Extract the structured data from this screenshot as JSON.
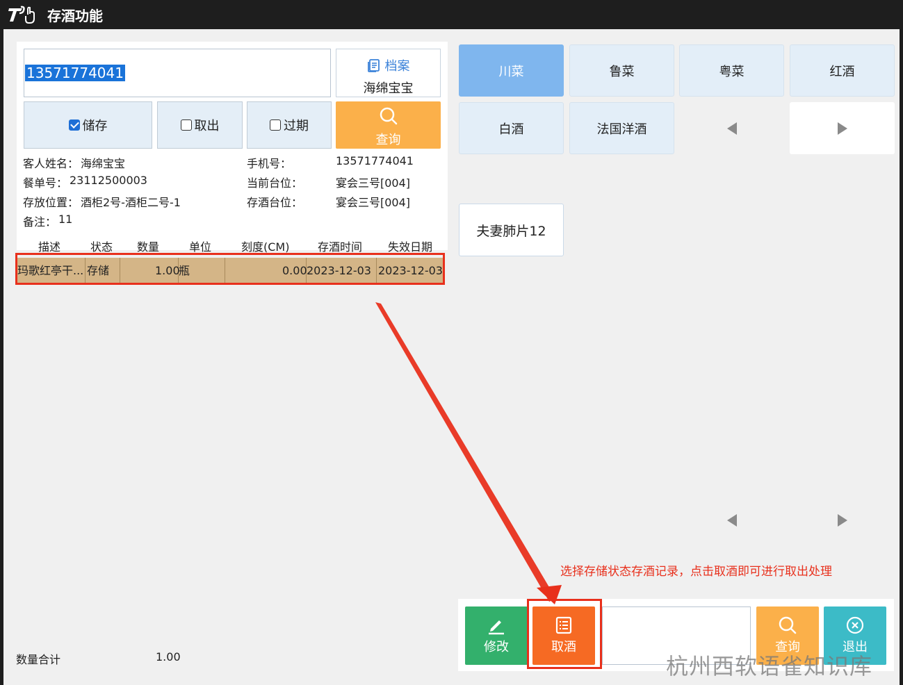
{
  "window": {
    "logo": "𝒯",
    "title": "存酒功能"
  },
  "search": {
    "phone_value": "13571774041"
  },
  "archive": {
    "label": "档案",
    "guest": "海绵宝宝"
  },
  "filters": {
    "store": "储存",
    "take": "取出",
    "expired": "过期",
    "query": "查询"
  },
  "info": {
    "guest_name_label": "客人姓名：",
    "guest_name": "海绵宝宝",
    "phone_label": "手机号：",
    "phone": "13571774041",
    "order_label": "餐单号：",
    "order": "23112500003",
    "current_table_label": "当前台位：",
    "current_table": "宴会三号[004]",
    "location_label": "存放位置：",
    "location": "酒柜2号-酒柜二号-1",
    "store_table_label": "存酒台位：",
    "store_table": "宴会三号[004]",
    "remark_label": "备注：",
    "remark": "11"
  },
  "table": {
    "headers": [
      "描述",
      "状态",
      "数量",
      "单位",
      "刻度(CM)",
      "存酒时间",
      "失效日期"
    ],
    "rows": [
      {
        "desc": "玛歌红亭干...",
        "status": "存储",
        "qty": "1.00",
        "unit": "瓶",
        "scale": "0.00",
        "store_time": "2023-12-03",
        "expire": "2023-12-03"
      }
    ]
  },
  "categories": [
    "川菜",
    "鲁菜",
    "粤菜",
    "红酒",
    "白酒",
    "法国洋酒"
  ],
  "dishes": [
    "夫妻肺片12"
  ],
  "annotation": "选择存储状态存酒记录，点击取酒即可进行取出处理",
  "actions": {
    "edit": "修改",
    "take": "取酒",
    "query": "查询",
    "exit": "退出"
  },
  "total": {
    "label": "数量合计",
    "value": "1.00"
  },
  "watermark": "杭州西软语雀知识库",
  "colors": {
    "accent_red": "#e8301c",
    "active_category": "#7fb6ee",
    "query_orange": "#fbb04a",
    "take_orange": "#f66a23",
    "edit_green": "#33b06c",
    "exit_teal": "#3cbbc7",
    "selected_row": "#d4b587"
  }
}
